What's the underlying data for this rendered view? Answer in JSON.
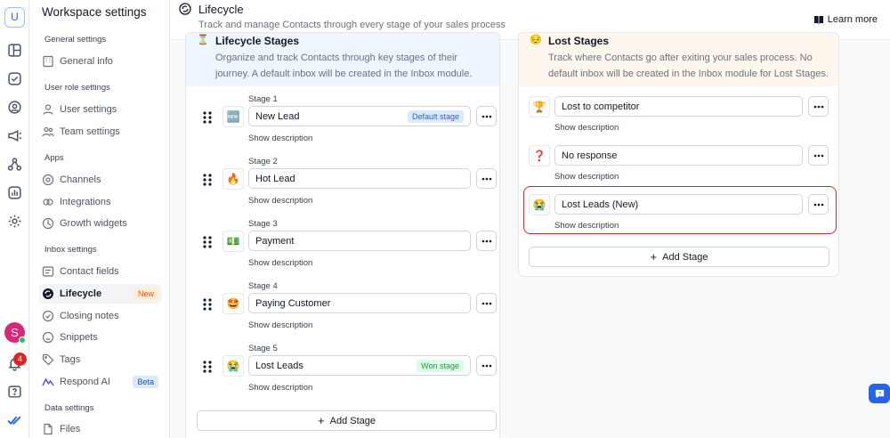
{
  "rail": {
    "workspace_initial": "U",
    "avatar_initial": "S",
    "notification_count": "4",
    "icons": [
      "layout-icon",
      "inbox-icon",
      "contact-icon",
      "broadcast-icon",
      "workflow-icon",
      "reports-icon",
      "settings-icon"
    ]
  },
  "sidebar": {
    "title": "Workspace settings",
    "sections": [
      {
        "label": "General settings",
        "items": [
          {
            "label": "General info",
            "icon": "building-icon"
          }
        ]
      },
      {
        "label": "User role settings",
        "items": [
          {
            "label": "User settings",
            "icon": "user-icon"
          },
          {
            "label": "Team settings",
            "icon": "team-icon"
          }
        ]
      },
      {
        "label": "Apps",
        "items": [
          {
            "label": "Channels",
            "icon": "channels-icon"
          },
          {
            "label": "Integrations",
            "icon": "integrations-icon"
          },
          {
            "label": "Growth widgets",
            "icon": "widgets-icon"
          }
        ]
      },
      {
        "label": "Inbox settings",
        "items": [
          {
            "label": "Contact fields",
            "icon": "contact-fields-icon"
          },
          {
            "label": "Lifecycle",
            "icon": "lifecycle-icon",
            "badge": "New",
            "active": true
          },
          {
            "label": "Closing notes",
            "icon": "check-circle-icon"
          },
          {
            "label": "Snippets",
            "icon": "snippets-icon"
          },
          {
            "label": "Tags",
            "icon": "tag-icon"
          },
          {
            "label": "Respond AI",
            "icon": "respond-ai-icon",
            "badge": "Beta"
          }
        ]
      },
      {
        "label": "Data settings",
        "items": [
          {
            "label": "Files",
            "icon": "files-icon"
          }
        ]
      }
    ]
  },
  "header": {
    "title": "Lifecycle",
    "subtitle": "Track and manage Contacts through every stage of your sales process",
    "learn_more": "Learn more"
  },
  "lifecycle_stages": {
    "title": "Lifecycle Stages",
    "description": "Organize and track Contacts through key stages of their journey. A default inbox will be created in the Inbox module.",
    "stages": [
      {
        "label": "Stage 1",
        "emoji": "🆕",
        "name": "New Lead",
        "badge": "Default stage",
        "show_description": "Show description"
      },
      {
        "label": "Stage 2",
        "emoji": "🔥",
        "name": "Hot Lead",
        "badge": "",
        "show_description": "Show description"
      },
      {
        "label": "Stage 3",
        "emoji": "💵",
        "name": "Payment",
        "badge": "",
        "show_description": "Show description"
      },
      {
        "label": "Stage 4",
        "emoji": "🤩",
        "name": "Paying Customer",
        "badge": "",
        "show_description": "Show description"
      },
      {
        "label": "Stage 5",
        "emoji": "😭",
        "name": "Lost Leads",
        "badge": "Won stage",
        "show_description": "Show description"
      }
    ],
    "add_stage": "Add Stage"
  },
  "lost_stages": {
    "title": "Lost Stages",
    "description": "Track where Contacts go after exiting your sales process. No default inbox will be created in the Inbox module for Lost Stages.",
    "stages": [
      {
        "emoji": "🏆",
        "name": "Lost to competitor",
        "show_description": "Show description"
      },
      {
        "emoji": "❓",
        "name": "No response",
        "show_description": "Show description"
      },
      {
        "emoji": "😭",
        "name": "Lost Leads (New)",
        "show_description": "Show description"
      }
    ],
    "add_stage": "Add Stage"
  },
  "colors": {
    "accent": "#2563eb",
    "new_badge": "#ea580c",
    "won_badge": "#16a34a",
    "highlight": "#dc2626"
  }
}
